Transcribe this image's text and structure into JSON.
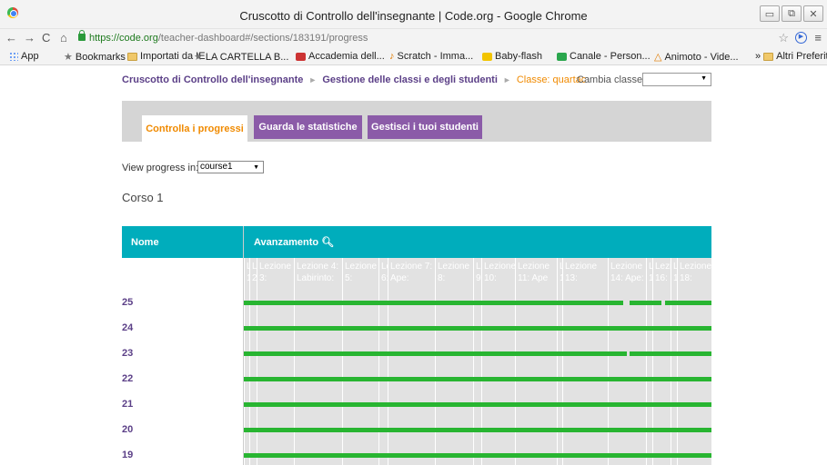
{
  "browser": {
    "title": "Cruscotto di Controllo dell'insegnante | Code.org - Google Chrome",
    "url_host": "https://code.org",
    "url_path": "/teacher-dashboard#/sections/183191/progress",
    "bookmarks": [
      {
        "label": "App",
        "icon": "apps-icon"
      },
      {
        "label": "Bookmarks",
        "icon": "star-icon"
      },
      {
        "label": "Importati da IE",
        "icon": "folder-icon"
      },
      {
        "label": "LA CARTELLA B...",
        "icon": "star-icon"
      },
      {
        "label": "Accademia dell...",
        "icon": "red-site-icon"
      },
      {
        "label": "Scratch - Imma...",
        "icon": "scratch-icon"
      },
      {
        "label": "Baby-flash",
        "icon": "yellow-site-icon"
      },
      {
        "label": "Canale - Person...",
        "icon": "green-site-icon"
      },
      {
        "label": "Animoto - Vide...",
        "icon": "animoto-icon"
      },
      {
        "label": "Altri Preferiti",
        "icon": "folder-icon"
      }
    ],
    "more_bookmarks": "»"
  },
  "breadcrumb": {
    "item1": "Cruscotto di Controllo dell'insegnante",
    "item2": "Gestione delle classi e degli studenti",
    "item3": "Classe: quartac",
    "separator": "►"
  },
  "switch_class_label": "Cambia classe:",
  "switch_class_value": "",
  "tabs": {
    "progress": "Controlla i progressi",
    "stats": "Guarda le statistiche",
    "students": "Gestisci i tuoi studenti"
  },
  "view_progress_label": "View progress in:",
  "view_progress_value": "course1",
  "course_title": "Corso 1",
  "table": {
    "name_header": "Nome",
    "progress_header": "Avanzamento",
    "lessons": [
      {
        "label": "L\n1:"
      },
      {
        "label": "L\n2:"
      },
      {
        "label": "Lezione\n3:"
      },
      {
        "label": "Lezione 4:\nLabirinto:"
      },
      {
        "label": "Lezione\n5:"
      },
      {
        "label": "Le\n6:"
      },
      {
        "label": "Lezione 7:\nApe:"
      },
      {
        "label": "Lezione\n8:"
      },
      {
        "label": "L\n9"
      },
      {
        "label": "Lezione\n10:"
      },
      {
        "label": "Lezione\n11: Ape"
      },
      {
        "label": "L\n1:"
      },
      {
        "label": "Lezione\n13:"
      },
      {
        "label": "Lezione\n14: Ape:"
      },
      {
        "label": "L\n1:"
      },
      {
        "label": "Lezi\n16:"
      },
      {
        "label": "L\n1:"
      },
      {
        "label": "Lezione\n18:"
      }
    ],
    "students": [
      "25",
      "24",
      "23",
      "22",
      "21",
      "20",
      "19"
    ]
  },
  "colors": {
    "header_teal": "#00adbc",
    "tab_purple": "#8b5ba8",
    "accent_orange": "#f08a00",
    "progress_green": "#28b531",
    "link_purple": "#5b3f87"
  }
}
